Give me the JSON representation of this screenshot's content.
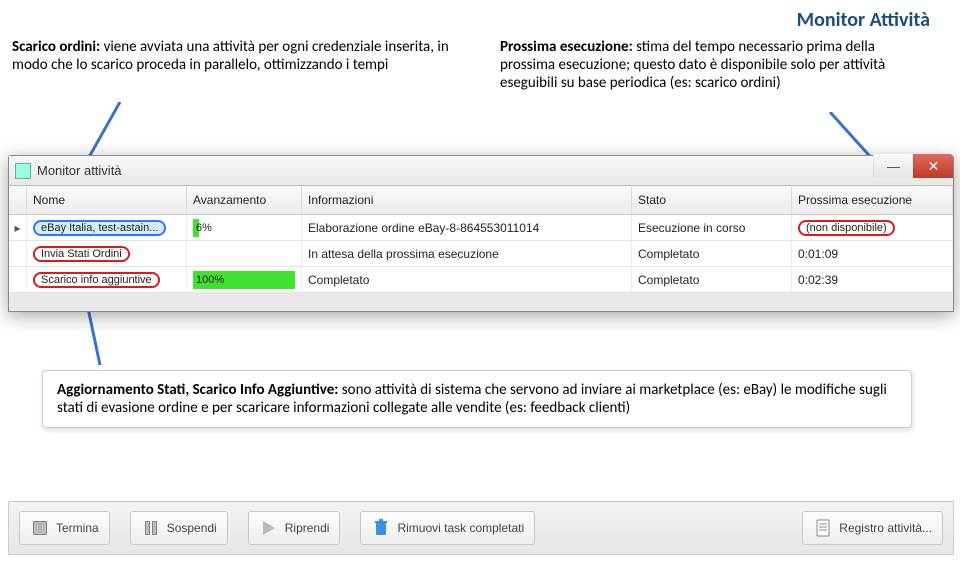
{
  "page_title": "Monitor Attività",
  "annotation_left": {
    "bold": "Scarico ordini: ",
    "text": "viene avviata una attività per ogni credenziale inserita, in modo che lo scarico proceda in parallelo, ottimizzando i tempi"
  },
  "annotation_right": {
    "bold": "Prossima esecuzione: ",
    "text": "stima del tempo necessario prima della prossima esecuzione; questo dato è disponibile solo per attività eseguibili su base periodica (es: scarico ordini)"
  },
  "annotation_bottom": {
    "bold": "Aggiornamento Stati, Scarico Info Aggiuntive: ",
    "text": "sono attività di sistema che servono ad inviare ai marketplace (es: eBay) le modifiche sugli stati di evasione ordine e per scaricare informazioni collegate alle vendite (es: feedback clienti)"
  },
  "window": {
    "title": "Monitor attività"
  },
  "columns": {
    "marker": "",
    "name": "Nome",
    "progress": "Avanzamento",
    "info": "Informazioni",
    "state": "Stato",
    "next": "Prossima esecuzione"
  },
  "rows": [
    {
      "marker": "▸",
      "name": "eBay Italia, test-astain...",
      "name_style": "blue",
      "progress_pct": 6,
      "progress_label": "6%",
      "info": "Elaborazione ordine eBay-8-864553011014",
      "state": "Esecuzione in corso",
      "next": "(non disponibile)",
      "next_style": "red"
    },
    {
      "marker": "",
      "name": "Invia Stati Ordini",
      "name_style": "red",
      "progress_pct": null,
      "progress_label": "",
      "info": "In attesa della prossima esecuzione",
      "state": "Completato",
      "next": "0:01:09",
      "next_style": "none"
    },
    {
      "marker": "",
      "name": "Scarico info aggiuntive",
      "name_style": "red",
      "progress_pct": 100,
      "progress_label": "100%",
      "info": "Completato",
      "state": "Completato",
      "next": "0:02:39",
      "next_style": "none"
    }
  ],
  "footer": {
    "terminate": "Termina",
    "suspend": "Sospendi",
    "resume": "Riprendi",
    "remove_completed": "Rimuovi task completati",
    "log": "Registro attività..."
  }
}
